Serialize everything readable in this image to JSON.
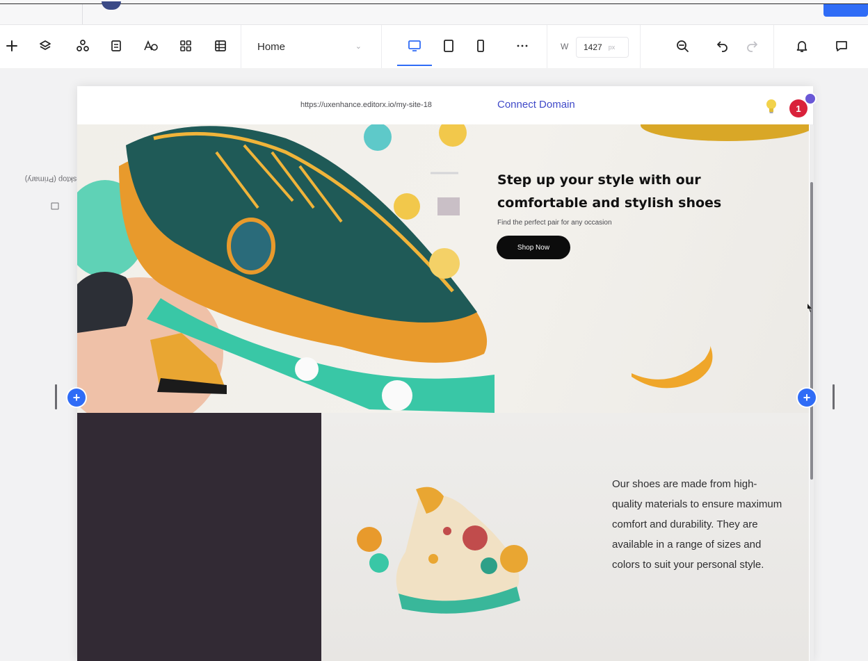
{
  "toolbar": {
    "page_selector": {
      "value": "Home"
    },
    "width_label": "W",
    "width_value": "1427",
    "width_unit": "px"
  },
  "site": {
    "url": "https://uxenhance.editorx.io/my-site-18",
    "connect_domain": "Connect Domain",
    "notification_count": "1",
    "breakpoint_label": "Desktop (Primary)"
  },
  "hero": {
    "title": "Step up your style with our comfortable and stylish shoes",
    "subtitle": "Find the perfect pair for any occasion",
    "cta": "Shop Now"
  },
  "section2": {
    "text": "Our shoes are made from high-quality materials to ensure maximum comfort and durability. They are available in a range of sizes and colors to suit your personal style."
  },
  "colors": {
    "accent": "#2f6cf6",
    "connect_domain": "#3f49c8",
    "dark_panel": "#322a34",
    "notification": "#d9213b"
  }
}
